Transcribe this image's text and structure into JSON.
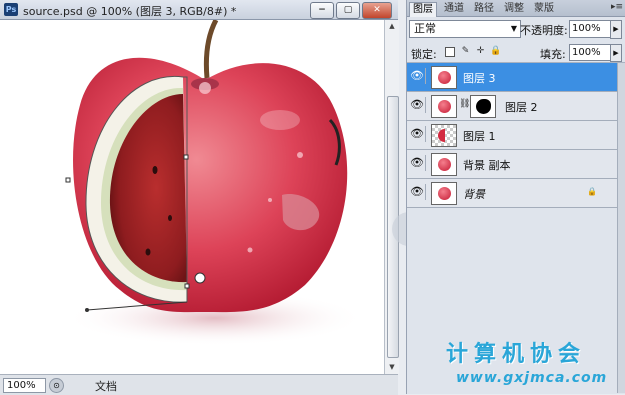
{
  "document": {
    "app_icon": "Ps",
    "title": "source.psd @ 100% (图层 3, RGB/8#) *",
    "window_buttons": {
      "minimize": "−",
      "restore": "▢",
      "close": "✕"
    },
    "zoom": "100%",
    "info": "文档"
  },
  "panel": {
    "tabs": [
      "图层",
      "通道",
      "路径",
      "调整",
      "蒙版"
    ],
    "menu_icon": "▸≡",
    "blend_mode": "正常",
    "opacity_label": "不透明度:",
    "opacity_value": "100%",
    "lock_label": "锁定:",
    "fill_label": "填充:",
    "fill_value": "100%",
    "layers": [
      {
        "name": "图层 3",
        "selected": true
      },
      {
        "name": "图层 2",
        "selected": false,
        "has_mask": true
      },
      {
        "name": "图层 1",
        "selected": false
      },
      {
        "name": "背景 副本",
        "selected": false
      },
      {
        "name": "背景",
        "selected": false,
        "locked": true,
        "italic": true
      }
    ]
  },
  "watermark": {
    "text": "计算机协会",
    "url": "www.gxjmca.com"
  },
  "colors": {
    "selection": "#3c8fe3",
    "apple": "#d32a40",
    "watermark": "#2aa6d8"
  }
}
